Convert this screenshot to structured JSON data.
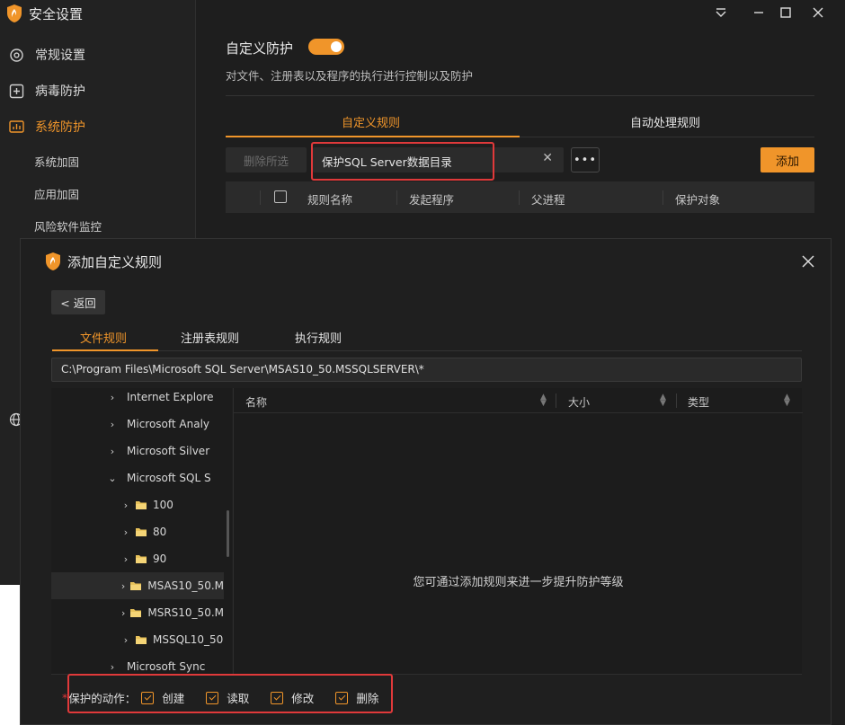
{
  "app": {
    "title": "安全设置"
  },
  "sidebar": {
    "items": [
      {
        "label": "常规设置",
        "icon": "gear-icon"
      },
      {
        "label": "病毒防护",
        "icon": "plus-square-icon"
      },
      {
        "label": "系统防护",
        "icon": "chart-icon"
      }
    ],
    "subitems": [
      "系统加固",
      "应用加固",
      "风险软件监控"
    ]
  },
  "main": {
    "title": "自定义防护",
    "toggle_on": true,
    "description": "对文件、注册表以及程序的执行进行控制以及防护",
    "tabs": [
      "自定义规则",
      "自动处理规则"
    ],
    "delete_label": "删除所选",
    "search_value": "保护SQL Server数据目录",
    "clear_glyph": "✕",
    "more_glyph": "•••",
    "add_label": "添加",
    "columns": [
      "规则名称",
      "发起程序",
      "父进程",
      "保护对象"
    ]
  },
  "dialog": {
    "title": "添加自定义规则",
    "back_label": "< 返回",
    "tabs": [
      "文件规则",
      "注册表规则",
      "执行规则"
    ],
    "path": "C:\\Program Files\\Microsoft SQL Server\\MSAS10_50.MSSQLSERVER\\*",
    "tree": [
      {
        "label": "Internet Explore",
        "expanded": false
      },
      {
        "label": "Microsoft Analy",
        "expanded": false
      },
      {
        "label": "Microsoft Silver",
        "expanded": false
      },
      {
        "label": "Microsoft SQL S",
        "expanded": true
      },
      {
        "label": "100",
        "expanded": false
      },
      {
        "label": "80",
        "expanded": false
      },
      {
        "label": "90",
        "expanded": false
      },
      {
        "label": "MSAS10_50.M",
        "expanded": false,
        "selected": true
      },
      {
        "label": "MSRS10_50.M",
        "expanded": false
      },
      {
        "label": "MSSQL10_50",
        "expanded": false
      },
      {
        "label": "Microsoft Sync",
        "expanded": false
      }
    ],
    "file_columns": [
      "名称",
      "大小",
      "类型"
    ],
    "empty_message": "您可通过添加规则来进一步提升防护等级",
    "actions_label": "保护的动作：",
    "required_mark": "*",
    "actions": [
      {
        "label": "创建",
        "checked": true
      },
      {
        "label": "读取",
        "checked": true
      },
      {
        "label": "修改",
        "checked": true
      },
      {
        "label": "删除",
        "checked": true
      }
    ]
  },
  "colors": {
    "accent": "#f0952a",
    "highlight": "#e0393a",
    "background": "#1e1e1e"
  }
}
